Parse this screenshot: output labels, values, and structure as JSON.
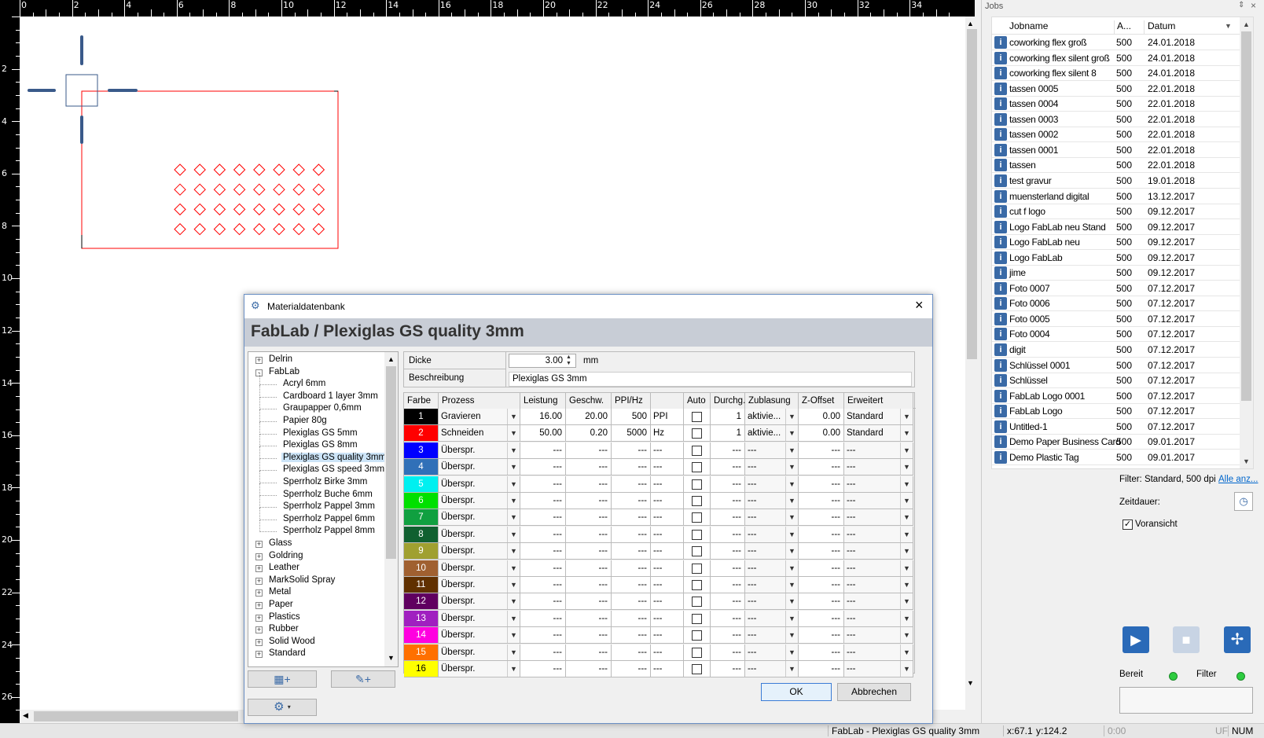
{
  "ruler": {
    "top_labels": [
      "0",
      "2",
      "4",
      "6",
      "8",
      "10",
      "12",
      "14",
      "16",
      "18",
      "20",
      "22",
      "24",
      "26",
      "28",
      "30",
      "32",
      "34"
    ],
    "left_labels": [
      "2",
      "4",
      "6",
      "8",
      "10",
      "12",
      "14",
      "16",
      "18",
      "20",
      "22",
      "24",
      "26"
    ]
  },
  "jobs": {
    "panel_title": "Jobs",
    "columns": [
      "Jobname",
      "A...",
      "Datum"
    ],
    "rows": [
      {
        "name": "coworking flex groß",
        "a": "500",
        "date": "24.01.2018"
      },
      {
        "name": "coworking flex silent groß",
        "a": "500",
        "date": "24.01.2018"
      },
      {
        "name": "coworking flex silent 8",
        "a": "500",
        "date": "24.01.2018"
      },
      {
        "name": "tassen 0005",
        "a": "500",
        "date": "22.01.2018"
      },
      {
        "name": "tassen 0004",
        "a": "500",
        "date": "22.01.2018"
      },
      {
        "name": "tassen 0003",
        "a": "500",
        "date": "22.01.2018"
      },
      {
        "name": "tassen 0002",
        "a": "500",
        "date": "22.01.2018"
      },
      {
        "name": "tassen 0001",
        "a": "500",
        "date": "22.01.2018"
      },
      {
        "name": "tassen",
        "a": "500",
        "date": "22.01.2018"
      },
      {
        "name": "test gravur",
        "a": "500",
        "date": "19.01.2018"
      },
      {
        "name": "muensterland digital",
        "a": "500",
        "date": "13.12.2017"
      },
      {
        "name": "cut f logo",
        "a": "500",
        "date": "09.12.2017"
      },
      {
        "name": "Logo FabLab neu Stand",
        "a": "500",
        "date": "09.12.2017"
      },
      {
        "name": "Logo FabLab neu",
        "a": "500",
        "date": "09.12.2017"
      },
      {
        "name": "Logo FabLab",
        "a": "500",
        "date": "09.12.2017"
      },
      {
        "name": "jime",
        "a": "500",
        "date": "09.12.2017"
      },
      {
        "name": "Foto 0007",
        "a": "500",
        "date": "07.12.2017"
      },
      {
        "name": "Foto 0006",
        "a": "500",
        "date": "07.12.2017"
      },
      {
        "name": "Foto 0005",
        "a": "500",
        "date": "07.12.2017"
      },
      {
        "name": "Foto 0004",
        "a": "500",
        "date": "07.12.2017"
      },
      {
        "name": "digit",
        "a": "500",
        "date": "07.12.2017"
      },
      {
        "name": "Schlüssel 0001",
        "a": "500",
        "date": "07.12.2017"
      },
      {
        "name": "Schlüssel",
        "a": "500",
        "date": "07.12.2017"
      },
      {
        "name": "FabLab Logo 0001",
        "a": "500",
        "date": "07.12.2017"
      },
      {
        "name": "FabLab Logo",
        "a": "500",
        "date": "07.12.2017"
      },
      {
        "name": "Untitled-1",
        "a": "500",
        "date": "07.12.2017"
      },
      {
        "name": "Demo Paper Business Card",
        "a": "500",
        "date": "09.01.2017"
      },
      {
        "name": "Demo Plastic Tag",
        "a": "500",
        "date": "09.01.2017"
      }
    ],
    "filter_text": "Filter: Standard, 500 dpi",
    "show_all_link": "Alle anz...",
    "duration_label": "Zeitdauer:",
    "preview_label": "Voransicht",
    "ready_label": "Bereit",
    "filter_label": "Filter"
  },
  "dialog": {
    "title": "Materialdatenbank",
    "header": "FabLab / Plexiglas GS quality 3mm",
    "tree": [
      {
        "label": "Delrin",
        "level": 0,
        "expander": "+"
      },
      {
        "label": "FabLab",
        "level": 0,
        "expander": "-"
      },
      {
        "label": "Acryl 6mm",
        "level": 1
      },
      {
        "label": "Cardboard 1 layer 3mm",
        "level": 1
      },
      {
        "label": "Graupapper 0,6mm",
        "level": 1
      },
      {
        "label": "Papier 80g",
        "level": 1
      },
      {
        "label": "Plexiglas GS 5mm",
        "level": 1
      },
      {
        "label": "Plexiglas GS 8mm",
        "level": 1
      },
      {
        "label": "Plexiglas GS quality 3mm",
        "level": 1,
        "selected": true
      },
      {
        "label": "Plexiglas GS speed 3mm",
        "level": 1
      },
      {
        "label": "Sperrholz Birke 3mm",
        "level": 1
      },
      {
        "label": "Sperrholz Buche 6mm",
        "level": 1
      },
      {
        "label": "Sperrholz Pappel 3mm",
        "level": 1
      },
      {
        "label": "Sperrholz Pappel 6mm",
        "level": 1
      },
      {
        "label": "Sperrholz Pappel 8mm",
        "level": 1
      },
      {
        "label": "Glass",
        "level": 0,
        "expander": "+"
      },
      {
        "label": "Goldring",
        "level": 0,
        "expander": "+"
      },
      {
        "label": "Leather",
        "level": 0,
        "expander": "+"
      },
      {
        "label": "MarkSolid Spray",
        "level": 0,
        "expander": "+"
      },
      {
        "label": "Metal",
        "level": 0,
        "expander": "+"
      },
      {
        "label": "Paper",
        "level": 0,
        "expander": "+"
      },
      {
        "label": "Plastics",
        "level": 0,
        "expander": "+"
      },
      {
        "label": "Rubber",
        "level": 0,
        "expander": "+"
      },
      {
        "label": "Solid Wood",
        "level": 0,
        "expander": "+"
      },
      {
        "label": "Standard",
        "level": 0,
        "expander": "+"
      }
    ],
    "thickness_label": "Dicke",
    "thickness_value": "3.00",
    "thickness_unit": "mm",
    "description_label": "Beschreibung",
    "description_value": "Plexiglas GS 3mm",
    "columns": [
      "Farbe",
      "Prozess",
      "Leistung",
      "Geschw.",
      "PPI/Hz",
      "",
      "Auto",
      "Durchg.",
      "Zublasung",
      "Z-Offset",
      "Erweitert"
    ],
    "rows": [
      {
        "num": "1",
        "color": "#000000",
        "numcolor": "#ffffff",
        "process": "Gravieren",
        "power": "16.00",
        "speed": "20.00",
        "ppi": "500",
        "unit": "PPI",
        "passes": "1",
        "air": "aktivie...",
        "zoff": "0.00",
        "ext": "Standard"
      },
      {
        "num": "2",
        "color": "#ff0000",
        "numcolor": "#ffffff",
        "process": "Schneiden",
        "power": "50.00",
        "speed": "0.20",
        "ppi": "5000",
        "unit": "Hz",
        "passes": "1",
        "air": "aktivie...",
        "zoff": "0.00",
        "ext": "Standard"
      },
      {
        "num": "3",
        "color": "#0000ff",
        "numcolor": "#ffffff",
        "process": "Überspr.",
        "power": "---",
        "speed": "---",
        "ppi": "---",
        "unit": "---",
        "passes": "---",
        "air": "---",
        "zoff": "---",
        "ext": "---"
      },
      {
        "num": "4",
        "color": "#3070b8",
        "numcolor": "#ffffff",
        "process": "Überspr.",
        "power": "---",
        "speed": "---",
        "ppi": "---",
        "unit": "---",
        "passes": "---",
        "air": "---",
        "zoff": "---",
        "ext": "---"
      },
      {
        "num": "5",
        "color": "#00f0f0",
        "numcolor": "#ffffff",
        "process": "Überspr.",
        "power": "---",
        "speed": "---",
        "ppi": "---",
        "unit": "---",
        "passes": "---",
        "air": "---",
        "zoff": "---",
        "ext": "---"
      },
      {
        "num": "6",
        "color": "#00e000",
        "numcolor": "#ffffff",
        "process": "Überspr.",
        "power": "---",
        "speed": "---",
        "ppi": "---",
        "unit": "---",
        "passes": "---",
        "air": "---",
        "zoff": "---",
        "ext": "---"
      },
      {
        "num": "7",
        "color": "#10a040",
        "numcolor": "#ffffff",
        "process": "Überspr.",
        "power": "---",
        "speed": "---",
        "ppi": "---",
        "unit": "---",
        "passes": "---",
        "air": "---",
        "zoff": "---",
        "ext": "---"
      },
      {
        "num": "8",
        "color": "#106030",
        "numcolor": "#ffffff",
        "process": "Überspr.",
        "power": "---",
        "speed": "---",
        "ppi": "---",
        "unit": "---",
        "passes": "---",
        "air": "---",
        "zoff": "---",
        "ext": "---"
      },
      {
        "num": "9",
        "color": "#a0a030",
        "numcolor": "#ffffff",
        "process": "Überspr.",
        "power": "---",
        "speed": "---",
        "ppi": "---",
        "unit": "---",
        "passes": "---",
        "air": "---",
        "zoff": "---",
        "ext": "---"
      },
      {
        "num": "10",
        "color": "#a06030",
        "numcolor": "#ffffff",
        "process": "Überspr.",
        "power": "---",
        "speed": "---",
        "ppi": "---",
        "unit": "---",
        "passes": "---",
        "air": "---",
        "zoff": "---",
        "ext": "---"
      },
      {
        "num": "11",
        "color": "#603000",
        "numcolor": "#ffffff",
        "process": "Überspr.",
        "power": "---",
        "speed": "---",
        "ppi": "---",
        "unit": "---",
        "passes": "---",
        "air": "---",
        "zoff": "---",
        "ext": "---"
      },
      {
        "num": "12",
        "color": "#600060",
        "numcolor": "#ffffff",
        "process": "Überspr.",
        "power": "---",
        "speed": "---",
        "ppi": "---",
        "unit": "---",
        "passes": "---",
        "air": "---",
        "zoff": "---",
        "ext": "---"
      },
      {
        "num": "13",
        "color": "#a020c0",
        "numcolor": "#ffffff",
        "process": "Überspr.",
        "power": "---",
        "speed": "---",
        "ppi": "---",
        "unit": "---",
        "passes": "---",
        "air": "---",
        "zoff": "---",
        "ext": "---"
      },
      {
        "num": "14",
        "color": "#ff00e0",
        "numcolor": "#ffffff",
        "process": "Überspr.",
        "power": "---",
        "speed": "---",
        "ppi": "---",
        "unit": "---",
        "passes": "---",
        "air": "---",
        "zoff": "---",
        "ext": "---"
      },
      {
        "num": "15",
        "color": "#ff7000",
        "numcolor": "#ffffff",
        "process": "Überspr.",
        "power": "---",
        "speed": "---",
        "ppi": "---",
        "unit": "---",
        "passes": "---",
        "air": "---",
        "zoff": "---",
        "ext": "---"
      },
      {
        "num": "16",
        "color": "#ffff00",
        "numcolor": "#000000",
        "process": "Überspr.",
        "power": "---",
        "speed": "---",
        "ppi": "---",
        "unit": "---",
        "passes": "---",
        "air": "---",
        "zoff": "---",
        "ext": "---"
      }
    ],
    "ok_label": "OK",
    "cancel_label": "Abbrechen"
  },
  "status": {
    "document": "FabLab - Plexiglas GS quality 3mm",
    "x": "x:67.1",
    "y": "y:124.2",
    "time": "0:00",
    "uf": "UF",
    "num": "NUM"
  },
  "colors": {
    "accent": "#3a6aa6",
    "design_red": "#ff0000",
    "selection": "#cce4f7"
  }
}
